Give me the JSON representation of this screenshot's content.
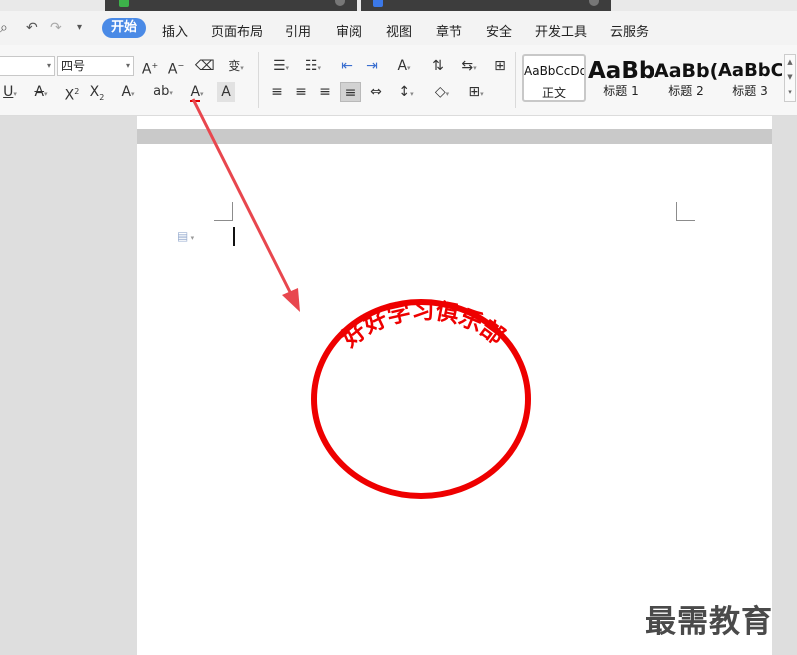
{
  "menu": {
    "items": [
      "开始",
      "插入",
      "页面布局",
      "引用",
      "审阅",
      "视图",
      "章节",
      "安全",
      "开发工具",
      "云服务"
    ]
  },
  "ribbon": {
    "font_size_value": "四号",
    "styles": [
      {
        "sample": "AaBbCcDd",
        "name": "正文"
      },
      {
        "sample": "AaBb",
        "name": "标题 1"
      },
      {
        "sample": "AaBb(",
        "name": "标题 2"
      },
      {
        "sample": "AaBbC",
        "name": "标题 3"
      }
    ]
  },
  "document": {
    "seal_text": "好好学习俱乐部"
  },
  "watermark": "最需教育",
  "colors": {
    "accent": "#4a8ae6",
    "seal_red": "#ee0000",
    "arrow": "#e8474e"
  }
}
